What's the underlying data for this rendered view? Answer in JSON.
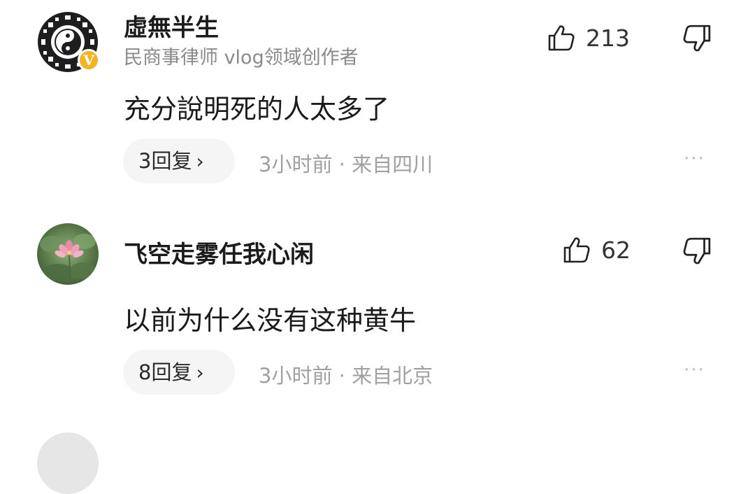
{
  "comments": [
    {
      "username": "虛無半生",
      "subtitle": "民商事律师 vlog领域创作者",
      "verified_badge": "V",
      "content": "充分說明死的人太多了",
      "likes": "213",
      "replies_label": "3回复",
      "meta": "3小时前 · 来自四川",
      "more": "···",
      "avatar_icon": "yin-yang-avatar",
      "badge_color": "#f5b321"
    },
    {
      "username": "飞空走雾任我心闲",
      "content": "以前为什么没有这种黄牛",
      "likes": "62",
      "replies_label": "8回复",
      "meta": "3小时前 · 来自北京",
      "more": "···",
      "avatar_icon": "lotus-flower-avatar"
    }
  ],
  "icons": {
    "like": "thumbs-up-icon",
    "dislike": "thumbs-down-icon",
    "reply_chevron": "chevron-right-icon",
    "chevron_glyph": "›"
  },
  "colors": {
    "text_primary": "#1b1b1b",
    "text_secondary": "#8a8a8a",
    "meta": "#a0a0a0",
    "reply_bg": "#f5f5f5"
  }
}
